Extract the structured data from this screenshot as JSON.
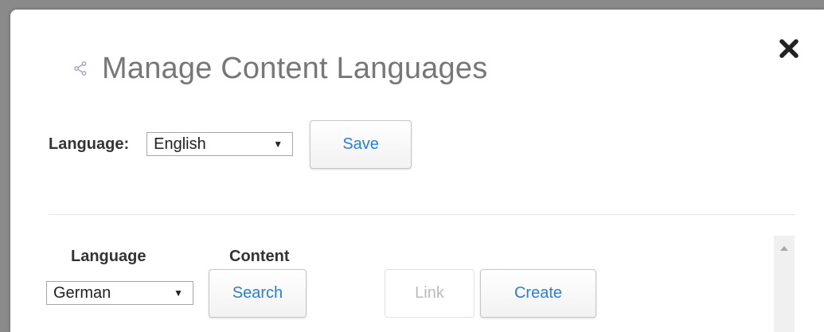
{
  "dialog": {
    "title": "Manage Content Languages",
    "title_icon": "share-icon",
    "close_icon": "close-icon"
  },
  "language_selector": {
    "label": "Language:",
    "selected": "English",
    "save_label": "Save"
  },
  "content_section": {
    "columns": {
      "language": "Language",
      "content": "Content"
    },
    "row": {
      "language_selected": "German",
      "search_label": "Search",
      "link_label": "Link",
      "create_label": "Create"
    }
  },
  "colors": {
    "title": "#777777",
    "link_blue": "#2a7fcf",
    "disabled": "#bbbbbb",
    "icon_lavender": "#a49ad6"
  }
}
